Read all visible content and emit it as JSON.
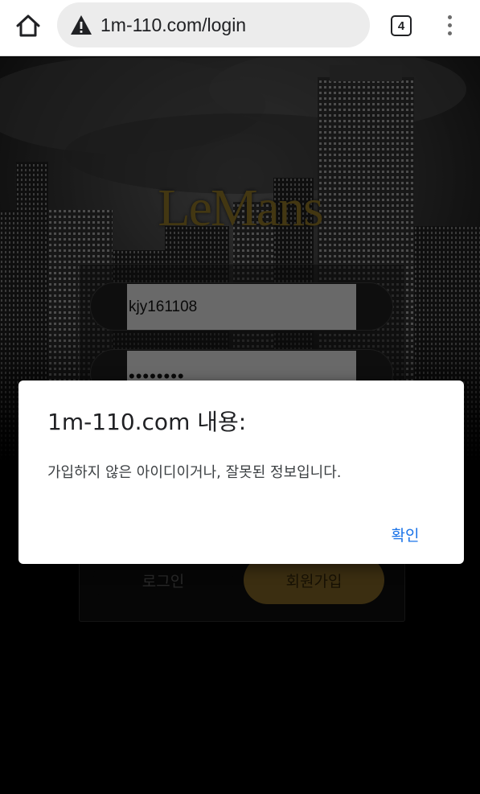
{
  "browser": {
    "url": "1m-110.com/login",
    "tab_count": "4",
    "security": "not-secure-warning-icon"
  },
  "page": {
    "logo": "LeMans",
    "user_id_value": "kjy161108",
    "password_value": "••••••••",
    "login_button": "로그인",
    "signup_button": "회원가입",
    "colors": {
      "gold": "#6c5520",
      "logo_gold": "#7a6522"
    }
  },
  "dialog": {
    "title": "1m-110.com 내용:",
    "message": "가입하지 않은 아이디이거나, 잘못된 정보입니다.",
    "ok_button": "확인",
    "accent": "#1a73e8"
  }
}
